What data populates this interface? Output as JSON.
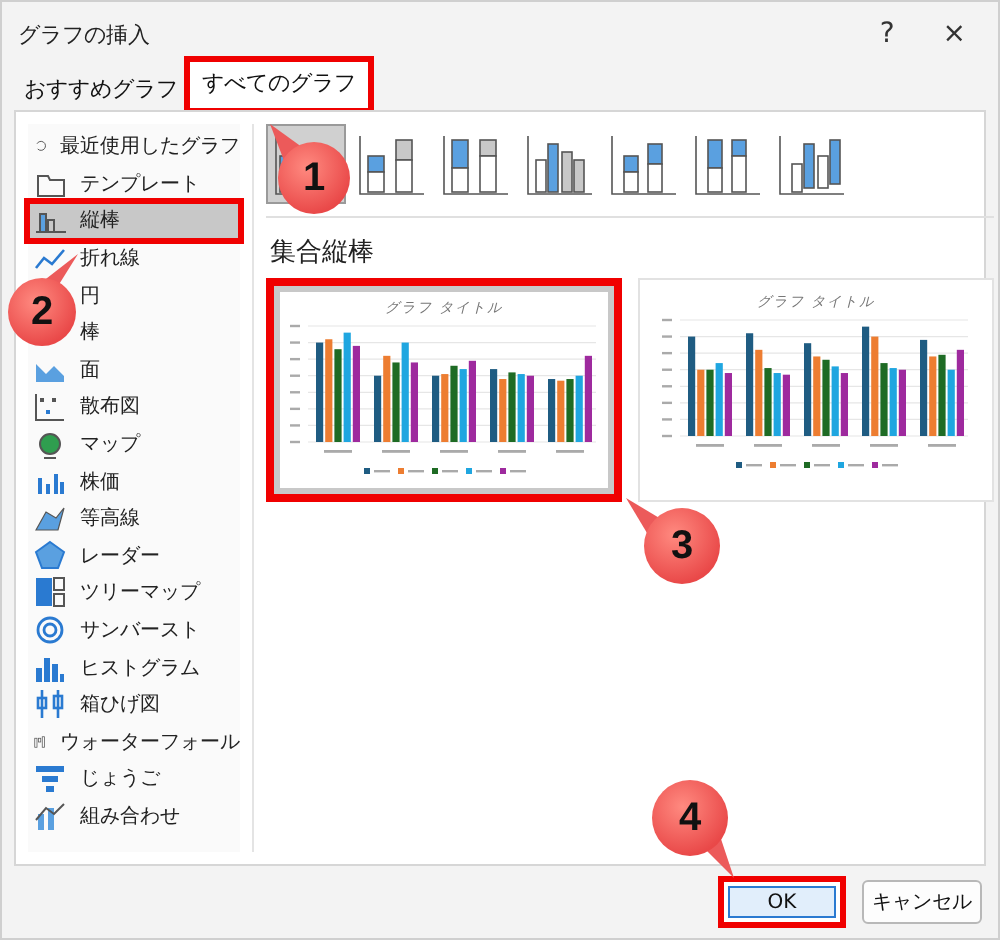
{
  "window": {
    "title": "グラフの挿入",
    "help": "?",
    "close": "×"
  },
  "tabs": [
    {
      "label": "おすすめグラフ",
      "selected": false,
      "highlighted": false
    },
    {
      "label": "すべてのグラフ",
      "selected": true,
      "highlighted": true
    }
  ],
  "sidebar": {
    "items": [
      {
        "label": "最近使用したグラフ",
        "kind": "recent",
        "selected": false,
        "highlighted": false
      },
      {
        "label": "テンプレート",
        "kind": "folder",
        "selected": false,
        "highlighted": false
      },
      {
        "label": "縦棒",
        "kind": "column",
        "selected": true,
        "highlighted": true
      },
      {
        "label": "折れ線",
        "kind": "line",
        "selected": false,
        "highlighted": false
      },
      {
        "label": "円",
        "selected": false,
        "highlighted": false
      },
      {
        "label": "棒",
        "selected": false,
        "highlighted": false
      },
      {
        "label": "面",
        "kind": "area",
        "selected": false,
        "highlighted": false
      },
      {
        "label": "散布図",
        "kind": "scatter",
        "selected": false,
        "highlighted": false
      },
      {
        "label": "マップ",
        "kind": "map",
        "selected": false,
        "highlighted": false
      },
      {
        "label": "株価",
        "kind": "stock",
        "selected": false,
        "highlighted": false
      },
      {
        "label": "等高線",
        "kind": "surface",
        "selected": false,
        "highlighted": false
      },
      {
        "label": "レーダー",
        "kind": "radar",
        "selected": false,
        "highlighted": false
      },
      {
        "label": "ツリーマップ",
        "kind": "treemap",
        "selected": false,
        "highlighted": false
      },
      {
        "label": "サンバースト",
        "kind": "sunburst",
        "selected": false,
        "highlighted": false
      },
      {
        "label": "ヒストグラム",
        "kind": "histogram",
        "selected": false,
        "highlighted": false
      },
      {
        "label": "箱ひげ図",
        "kind": "box",
        "selected": false,
        "highlighted": false
      },
      {
        "label": "ウォーターフォール",
        "kind": "waterfall",
        "selected": false,
        "highlighted": false
      },
      {
        "label": "じょうご",
        "kind": "funnel",
        "selected": false,
        "highlighted": false
      },
      {
        "label": "組み合わせ",
        "kind": "combo",
        "selected": false,
        "highlighted": false
      }
    ]
  },
  "chart_types": [
    {
      "kind": "clustered",
      "selected": true
    },
    {
      "kind": "stacked",
      "selected": false
    },
    {
      "kind": "stacked100",
      "selected": false
    },
    {
      "kind": "clustered3d",
      "selected": false
    },
    {
      "kind": "stacked3d",
      "selected": false
    },
    {
      "kind": "full3d",
      "selected": false
    },
    {
      "kind": "column3d",
      "selected": false
    }
  ],
  "subtype_title": "集合縦棒",
  "previews": [
    {
      "title": "グラフ タイトル",
      "kind": "by-branch",
      "highlighted": true
    },
    {
      "title": "グラフ タイトル",
      "kind": "by-month",
      "highlighted": false
    }
  ],
  "buttons": [
    {
      "label": "OK",
      "primary": true,
      "highlighted": true
    },
    {
      "label": "キャンセル",
      "primary": false,
      "highlighted": false
    }
  ],
  "callouts": [
    {
      "number": "1"
    },
    {
      "number": "2"
    },
    {
      "number": "3"
    },
    {
      "number": "4"
    }
  ]
}
